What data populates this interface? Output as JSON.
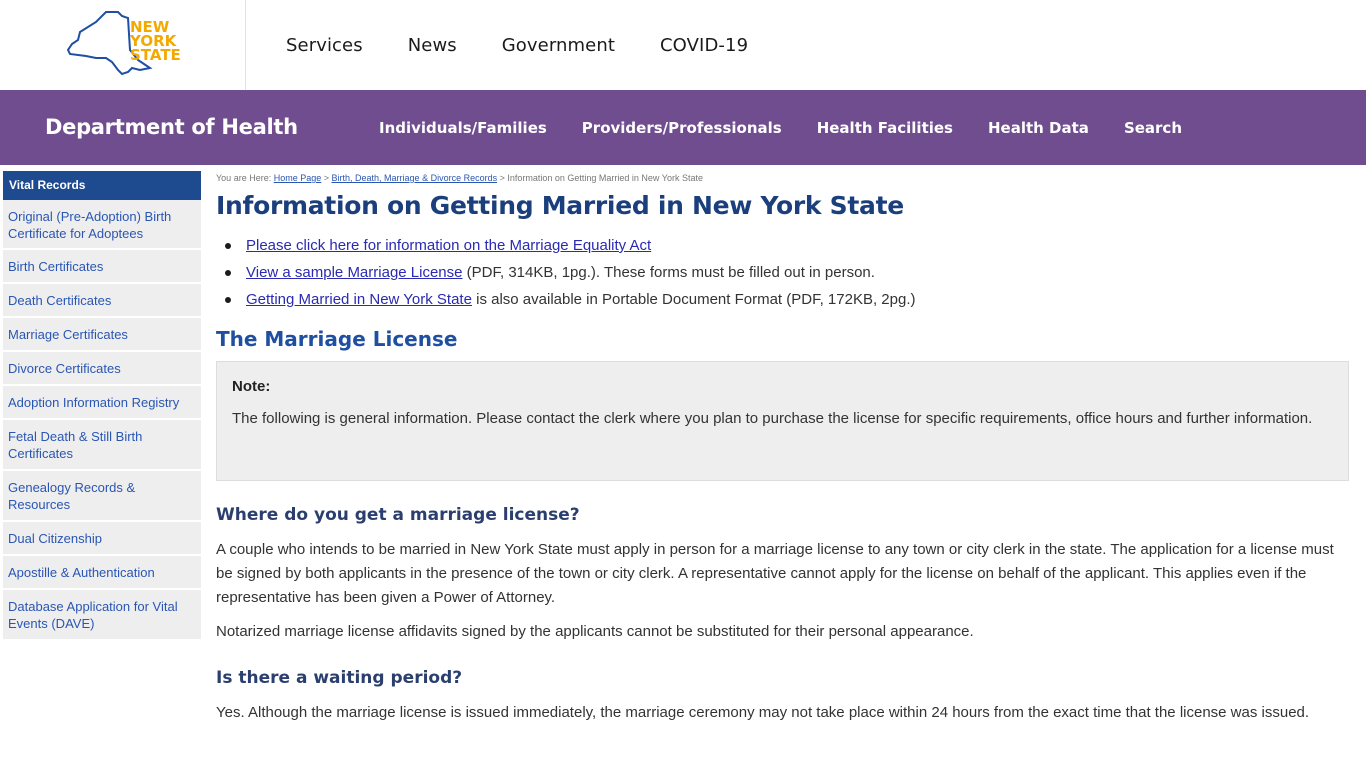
{
  "logo": {
    "line1": "NEW",
    "line2": "YORK",
    "line3": "STATE"
  },
  "top_nav": [
    "Services",
    "News",
    "Government",
    "COVID-19"
  ],
  "agency": {
    "title": "Department of Health",
    "nav": [
      "Individuals/Families",
      "Providers/Professionals",
      "Health Facilities",
      "Health Data",
      "Search"
    ]
  },
  "sidebar": {
    "heading": "Vital Records",
    "items": [
      "Original (Pre-Adoption) Birth Certificate for Adoptees",
      "Birth Certificates",
      "Death Certificates",
      "Marriage Certificates",
      "Divorce Certificates",
      "Adoption Information Registry",
      "Fetal Death & Still Birth Certificates",
      "Genealogy Records & Resources",
      "Dual Citizenship",
      "Apostille & Authentication",
      "Database Application for Vital Events (DAVE)"
    ]
  },
  "breadcrumb": {
    "prefix": "You are Here:",
    "home": "Home Page",
    "section": "Birth, Death, Marriage & Divorce Records",
    "current": "Information on Getting Married in New York State"
  },
  "page_title": "Information on Getting Married in New York State",
  "links": [
    {
      "link": "Please click here for information on the Marriage Equality Act",
      "rest": ""
    },
    {
      "link": "View a sample Marriage License",
      "rest": " (PDF, 314KB, 1pg.). These forms must be filled out in person."
    },
    {
      "link": "Getting Married in New York State",
      "rest": " is also available in Portable Document Format (PDF, 172KB, 2pg.)"
    }
  ],
  "section_heading": "The Marriage License",
  "note": {
    "label": "Note:",
    "text": "The following is general information. Please contact the clerk where you plan to purchase the license for specific requirements, office hours and further information."
  },
  "q1": {
    "heading": "Where do you get a marriage license?",
    "p1": "A couple who intends to be married in New York State must apply in person for a marriage license to any town or city clerk in the state. The application for a license must be signed by both applicants in the presence of the town or city clerk. A representative cannot apply for the license on behalf of the applicant. This applies even if the representative has been given a Power of Attorney.",
    "p2": "Notarized marriage license affidavits signed by the applicants cannot be substituted for their personal appearance."
  },
  "q2": {
    "heading": "Is there a waiting period?",
    "p1": "Yes. Although the marriage license is issued immediately, the marriage ceremony may not take place within 24 hours from the exact time that the license was issued."
  },
  "colors": {
    "purple": "#6f4d8f",
    "navy": "#1e4a8f",
    "logo_gold": "#f2a900",
    "logo_blue": "#1f4fa3"
  }
}
